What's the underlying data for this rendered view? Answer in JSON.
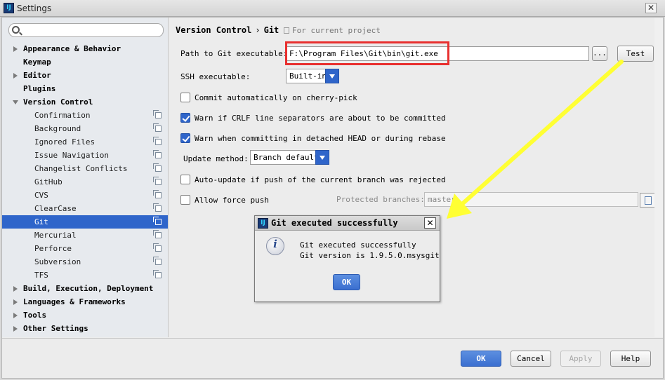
{
  "window": {
    "title": "Settings",
    "close_glyph": "✕"
  },
  "search": {
    "placeholder": ""
  },
  "sidebar": {
    "items": [
      {
        "label": "Appearance & Behavior",
        "level": "top",
        "expandable": true,
        "expanded": false
      },
      {
        "label": "Keymap",
        "level": "top",
        "expandable": false
      },
      {
        "label": "Editor",
        "level": "top",
        "expandable": true,
        "expanded": false
      },
      {
        "label": "Plugins",
        "level": "top",
        "expandable": false
      },
      {
        "label": "Version Control",
        "level": "top",
        "expandable": true,
        "expanded": true
      },
      {
        "label": "Confirmation",
        "level": "child"
      },
      {
        "label": "Background",
        "level": "child"
      },
      {
        "label": "Ignored Files",
        "level": "child"
      },
      {
        "label": "Issue Navigation",
        "level": "child"
      },
      {
        "label": "Changelist Conflicts",
        "level": "child"
      },
      {
        "label": "GitHub",
        "level": "child"
      },
      {
        "label": "CVS",
        "level": "child"
      },
      {
        "label": "ClearCase",
        "level": "child"
      },
      {
        "label": "Git",
        "level": "child",
        "selected": true
      },
      {
        "label": "Mercurial",
        "level": "child"
      },
      {
        "label": "Perforce",
        "level": "child"
      },
      {
        "label": "Subversion",
        "level": "child"
      },
      {
        "label": "TFS",
        "level": "child"
      },
      {
        "label": "Build, Execution, Deployment",
        "level": "top",
        "expandable": true,
        "expanded": false
      },
      {
        "label": "Languages & Frameworks",
        "level": "top",
        "expandable": true,
        "expanded": false
      },
      {
        "label": "Tools",
        "level": "top",
        "expandable": true,
        "expanded": false
      },
      {
        "label": "Other Settings",
        "level": "top",
        "expandable": true,
        "expanded": false
      }
    ]
  },
  "main": {
    "breadcrumb": {
      "parent": "Version Control",
      "separator": "›",
      "current": "Git"
    },
    "for_project": "For current project",
    "path_label": "Path to Git executable:",
    "path_value": "F:\\Program Files\\Git\\bin\\git.exe",
    "browse_label": "...",
    "test_label": "Test",
    "ssh_label": "SSH executable:",
    "ssh_value": "Built-in",
    "options": [
      {
        "label": "Commit automatically on cherry-pick",
        "checked": false
      },
      {
        "label": "Warn if CRLF line separators are about to be committed",
        "checked": true
      },
      {
        "label": "Warn when committing in detached HEAD or during rebase",
        "checked": true
      }
    ],
    "update_method_label": "Update method:",
    "update_method_value": "Branch default",
    "auto_update_label": "Auto-update if push of the current branch was rejected",
    "auto_update_checked": false,
    "force_push_label": "Allow force push",
    "force_push_checked": false,
    "protected_label": "Protected branches:",
    "protected_value": "master"
  },
  "dialog": {
    "title": "Git executed successfully",
    "close_glyph": "✕",
    "info_glyph": "i",
    "line1": "Git executed successfully",
    "line2": "Git version is 1.9.5.0.msysgit",
    "ok_label": "OK"
  },
  "footer": {
    "ok": "OK",
    "cancel": "Cancel",
    "apply": "Apply",
    "help": "Help"
  },
  "colors": {
    "selection": "#2f65ca",
    "highlight": "#e8302f",
    "annotation_arrow": "#ffff33"
  },
  "icons": {
    "app": "intellij-icon",
    "search": "search-icon",
    "copy": "project-settings-icon",
    "info": "info-icon"
  }
}
